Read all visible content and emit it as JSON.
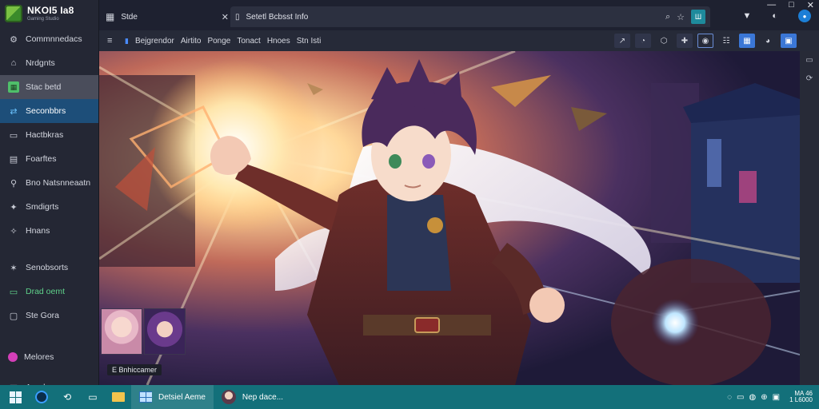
{
  "sidebar": {
    "brand_title": "NKOI5 Ia8",
    "brand_sub": "Gaming Studio",
    "items": [
      {
        "label": "Commnnedacs",
        "icon": "gear-icon",
        "glyph": "⚙"
      },
      {
        "label": "Nrdgnts",
        "icon": "home-icon",
        "glyph": "⌂"
      },
      {
        "label": "Stac betd",
        "icon": "tile-icon",
        "glyph": "▦"
      },
      {
        "label": "Seconbbrs",
        "icon": "share-icon",
        "glyph": "⇄"
      },
      {
        "label": "Hactbkras",
        "icon": "folder-icon",
        "glyph": "▭"
      },
      {
        "label": "Foarftes",
        "icon": "book-icon",
        "glyph": "▤"
      },
      {
        "label": "Bno Natsnneaatn",
        "icon": "link-icon",
        "glyph": "⚲"
      },
      {
        "label": "Smdigrts",
        "icon": "tool-icon",
        "glyph": "✦"
      },
      {
        "label": "Hnans",
        "icon": "wrench-icon",
        "glyph": "✧"
      },
      {
        "label": "Senobsorts",
        "icon": "star-icon",
        "glyph": "✶"
      },
      {
        "label": "Drad oemt",
        "icon": "monitor-icon",
        "glyph": "▭"
      },
      {
        "label": "Ste Gora",
        "icon": "window-icon",
        "glyph": "▢"
      },
      {
        "label": "Melores",
        "icon": "circle-icon",
        "glyph": ""
      },
      {
        "label": "Argebacor",
        "icon": "calendar-icon",
        "glyph": "▤",
        "trail": "▴"
      }
    ]
  },
  "tabs": {
    "tab1_label": "Stde",
    "tab2_label": "Setetl Bcbsst Info",
    "grid_glyph": "▦",
    "close_glyph": "✕",
    "page_glyph": "▯"
  },
  "tab_tools": [
    "⌕",
    "☆",
    "Ш"
  ],
  "right_icons": [
    "▼",
    "◐",
    "●"
  ],
  "window_controls": [
    "—",
    "□",
    "✕"
  ],
  "toolbar": {
    "menu_glyph": "≡",
    "bookmark_glyph": "▮",
    "bookmarks": [
      "Bejgrendor",
      "Airtito",
      "Ponge",
      "Tonact",
      "Hnoes",
      "Stn Isti"
    ],
    "icons": [
      "↗",
      "◔",
      "⬡",
      "✚",
      "◉",
      "☷",
      "▦",
      "◕",
      "▣"
    ]
  },
  "right_strip": [
    "▭",
    "⟳"
  ],
  "art": {
    "caption": "E Bnhiccamer"
  },
  "taskbar": {
    "win1_label": "Detsiel Aeme",
    "win2_label": "Nep dace...",
    "tray_icons": [
      "◌",
      "▭",
      "◍",
      "⊕",
      "▣"
    ],
    "clock_line1": "MA 46",
    "clock_line2": "1 L6000"
  },
  "colors": {
    "accent": "#1d4e79",
    "taskbar": "#13707a",
    "highlight_tile": "#4fbf6a"
  }
}
